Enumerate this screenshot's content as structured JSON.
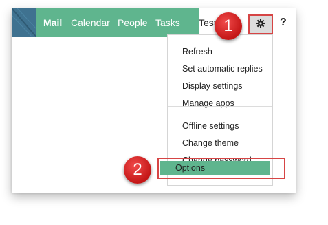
{
  "nav": {
    "items": [
      "Mail",
      "Calendar",
      "People",
      "Tasks"
    ],
    "active": "Mail"
  },
  "user": {
    "name": "Test"
  },
  "toolbar": {
    "settings_icon": "gear-icon",
    "help_label": "?"
  },
  "menu": {
    "group1": [
      "Refresh",
      "Set automatic replies",
      "Display settings",
      "Manage apps"
    ],
    "group2": [
      "Offline settings",
      "Change theme",
      "Change password"
    ],
    "highlighted": "Options"
  },
  "callouts": [
    "1",
    "2"
  ],
  "colors": {
    "nav_green": "#5fb58e",
    "highlight_red": "#d64545",
    "badge_red": "#d92b2b"
  }
}
